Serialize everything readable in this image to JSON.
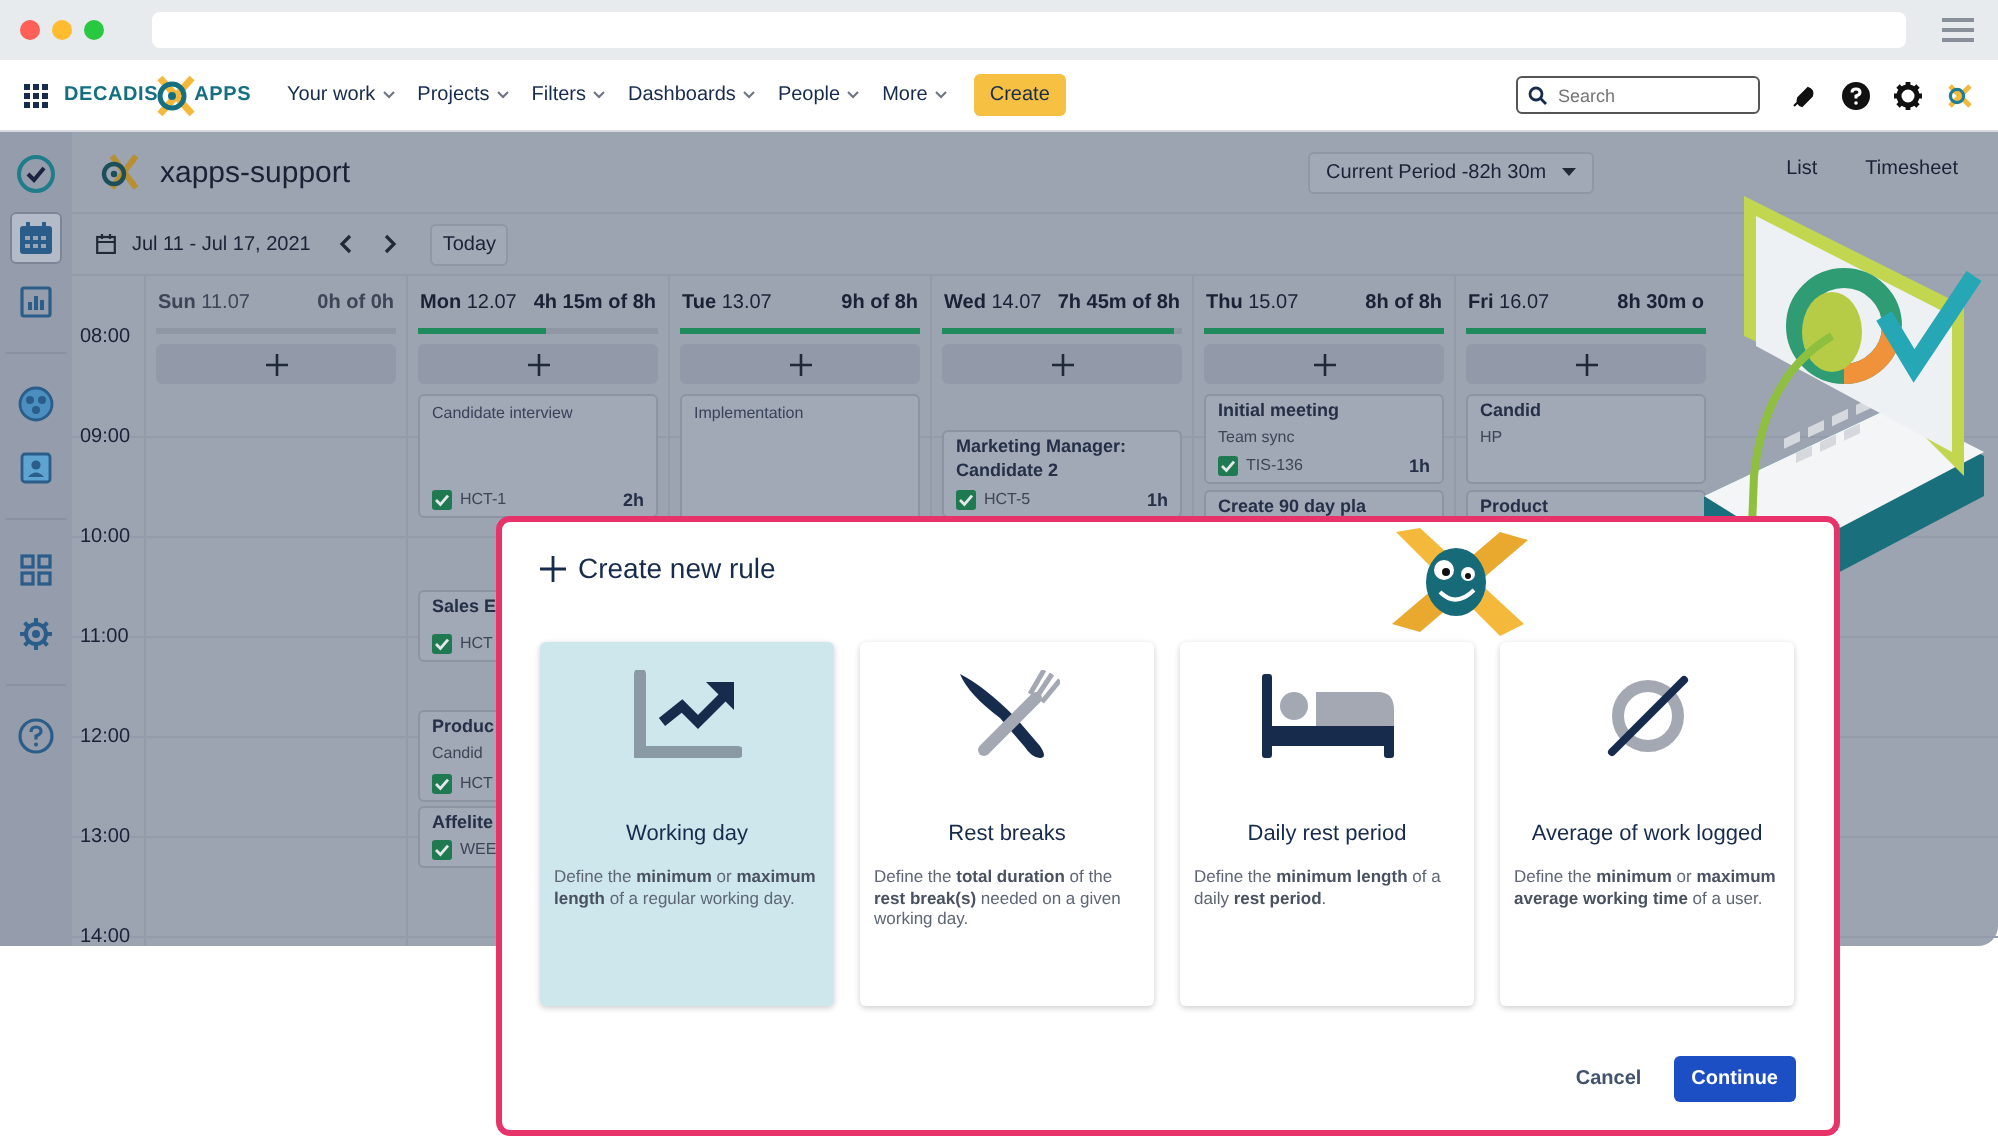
{
  "nav": {
    "logo": [
      "DECADIS",
      "APPS"
    ],
    "menu": [
      {
        "label": "Your work"
      },
      {
        "label": "Projects"
      },
      {
        "label": "Filters"
      },
      {
        "label": "Dashboards"
      },
      {
        "label": "People"
      },
      {
        "label": "More"
      }
    ],
    "create_button": "Create",
    "search": {
      "placeholder": "Search"
    }
  },
  "sidebar": {
    "items": [
      {
        "kind": "check",
        "selected": false
      },
      {
        "kind": "calendar",
        "selected": true
      },
      {
        "kind": "report",
        "selected": false
      },
      {
        "kind": "team",
        "selected": false
      },
      {
        "kind": "contact",
        "selected": false
      },
      {
        "kind": "apps",
        "selected": false
      },
      {
        "kind": "settings",
        "selected": false
      },
      {
        "kind": "help",
        "selected": false
      }
    ]
  },
  "header": {
    "project": "xapps-support",
    "period": "Current Period -82h 30m",
    "views": [
      {
        "label": "List",
        "selected": false
      },
      {
        "label": "Timesheet",
        "selected": false
      }
    ]
  },
  "toolbar": {
    "date_range": "Jul 11 - Jul 17, 2021",
    "today_button": "Today"
  },
  "calendar": {
    "hours": [
      "08:00",
      "09:00",
      "10:00",
      "11:00",
      "12:00",
      "13:00",
      "14:00"
    ],
    "days": [
      {
        "name": "Sun",
        "date": "11.07",
        "total": "0h of 0h",
        "dimmed": true
      },
      {
        "name": "Mon",
        "date": "12.07",
        "total": "4h 15m of 8h",
        "dimmed": false,
        "level": 0.53,
        "events": [
          {
            "kind": "note",
            "title": "Candidate interview",
            "key": "HCT-1",
            "duration": "2h",
            "checked": true
          },
          {
            "kind": "task",
            "title": "Sales E",
            "key": "HCT",
            "checked": true
          },
          {
            "kind": "task",
            "title": "Produc",
            "subtitle": "Candid",
            "key": "HCT",
            "checked": true
          },
          {
            "kind": "task",
            "title": "Affelite",
            "key": "WEE",
            "checked": true
          }
        ]
      },
      {
        "name": "Tue",
        "date": "13.07",
        "total": "9h of 8h",
        "dimmed": false,
        "level": 1,
        "events": [
          {
            "kind": "note",
            "title": "Implementation"
          }
        ]
      },
      {
        "name": "Wed",
        "date": "14.07",
        "total": "7h 45m of 8h",
        "dimmed": false,
        "level": 0.97,
        "events": [
          {
            "kind": "task",
            "title": "Marketing Manager: Candidate 2",
            "key": "HCT-5",
            "duration": "1h",
            "checked": true
          }
        ]
      },
      {
        "name": "Thu",
        "date": "15.07",
        "total": "8h of 8h",
        "dimmed": false,
        "level": 1,
        "events": [
          {
            "kind": "task",
            "title": "Initial meeting",
            "subtitle": "Team sync",
            "key": "TIS-136",
            "duration": "1h",
            "checked": true
          },
          {
            "kind": "task",
            "title": "Create 90 day pla"
          }
        ]
      },
      {
        "name": "Fri",
        "date": "16.07",
        "total": "8h 30m o",
        "dimmed": false,
        "level": 1,
        "events": [
          {
            "kind": "task",
            "title": "Candid",
            "subtitle": "HP"
          },
          {
            "kind": "task",
            "title": "Product"
          }
        ]
      }
    ]
  },
  "modal": {
    "title": "Create new rule",
    "options": [
      {
        "kind": "chart",
        "title": "Working day",
        "description": "Define the **minimum** or **maximum length** of a regular working day.",
        "selected": true
      },
      {
        "kind": "cutlery",
        "title": "Rest breaks",
        "description": "Define the **total duration** of the **rest break(s)** needed on a given working day.",
        "selected": false
      },
      {
        "kind": "bed",
        "title": "Daily rest period",
        "description": "Define the **minimum length** of a daily **rest period**.",
        "selected": false
      },
      {
        "kind": "empty-set",
        "title": "Average of work logged",
        "description": "Define the **minimum** or **maximum average working time** of a user.",
        "selected": false
      }
    ],
    "buttons": [
      {
        "label": "Cancel",
        "kind": "secondary"
      },
      {
        "label": "Continue",
        "kind": "primary"
      }
    ]
  }
}
